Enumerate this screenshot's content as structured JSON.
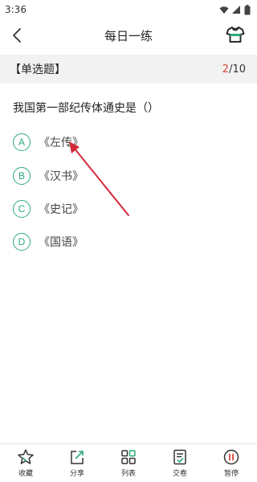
{
  "status_bar": {
    "time": "3:36",
    "icons": [
      "wifi-icon",
      "signal-icon",
      "battery-icon"
    ]
  },
  "header": {
    "title": "每日一练",
    "back_icon": "chevron-left-icon",
    "right_icon": "shirt-icon"
  },
  "question_type": {
    "label": "【单选题】",
    "current": "2",
    "total": "/10"
  },
  "question": {
    "text": "我国第一部纪传体通史是（）",
    "options": [
      {
        "letter": "A",
        "text": "《左传》"
      },
      {
        "letter": "B",
        "text": "《汉书》"
      },
      {
        "letter": "C",
        "text": "《史记》"
      },
      {
        "letter": "D",
        "text": "《国语》"
      }
    ]
  },
  "bottom_bar": {
    "tabs": [
      {
        "label": "收藏",
        "icon": "star-icon"
      },
      {
        "label": "分享",
        "icon": "share-icon"
      },
      {
        "label": "列表",
        "icon": "grid-list-icon"
      },
      {
        "label": "交卷",
        "icon": "submit-paper-icon"
      },
      {
        "label": "暂停",
        "icon": "pause-icon"
      }
    ]
  },
  "colors": {
    "accent": "#2daa78",
    "counter_current": "#d9463b",
    "arrow": "#d42a3a"
  }
}
